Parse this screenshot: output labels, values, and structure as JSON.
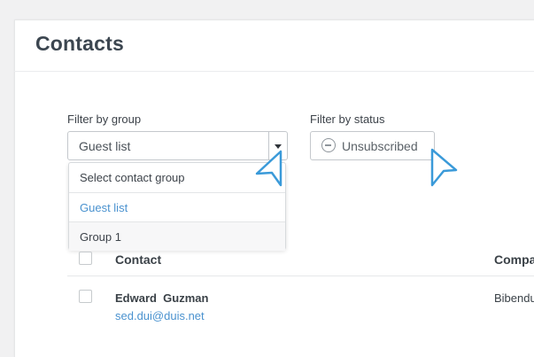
{
  "page": {
    "title": "Contacts"
  },
  "filters": {
    "group_label": "Filter by group",
    "group_value": "Guest list",
    "status_label": "Filter by status",
    "status_value": "Unsubscribed",
    "status_icon": "minus-circle-icon"
  },
  "group_dropdown": {
    "items": [
      {
        "label": "Select contact group"
      },
      {
        "label": "Guest list",
        "selected": true
      },
      {
        "label": "Group 1"
      }
    ]
  },
  "table": {
    "columns": [
      "Contact",
      "Compa"
    ],
    "rows": [
      {
        "name": "Edward  Guzman",
        "email": "sed.dui@duis.net",
        "company": "Bibendu"
      }
    ]
  },
  "colors": {
    "accent": "#4a92cf",
    "cursor": "#3a9ad9",
    "text": "#3a4147",
    "border": "#c4c8cc"
  }
}
